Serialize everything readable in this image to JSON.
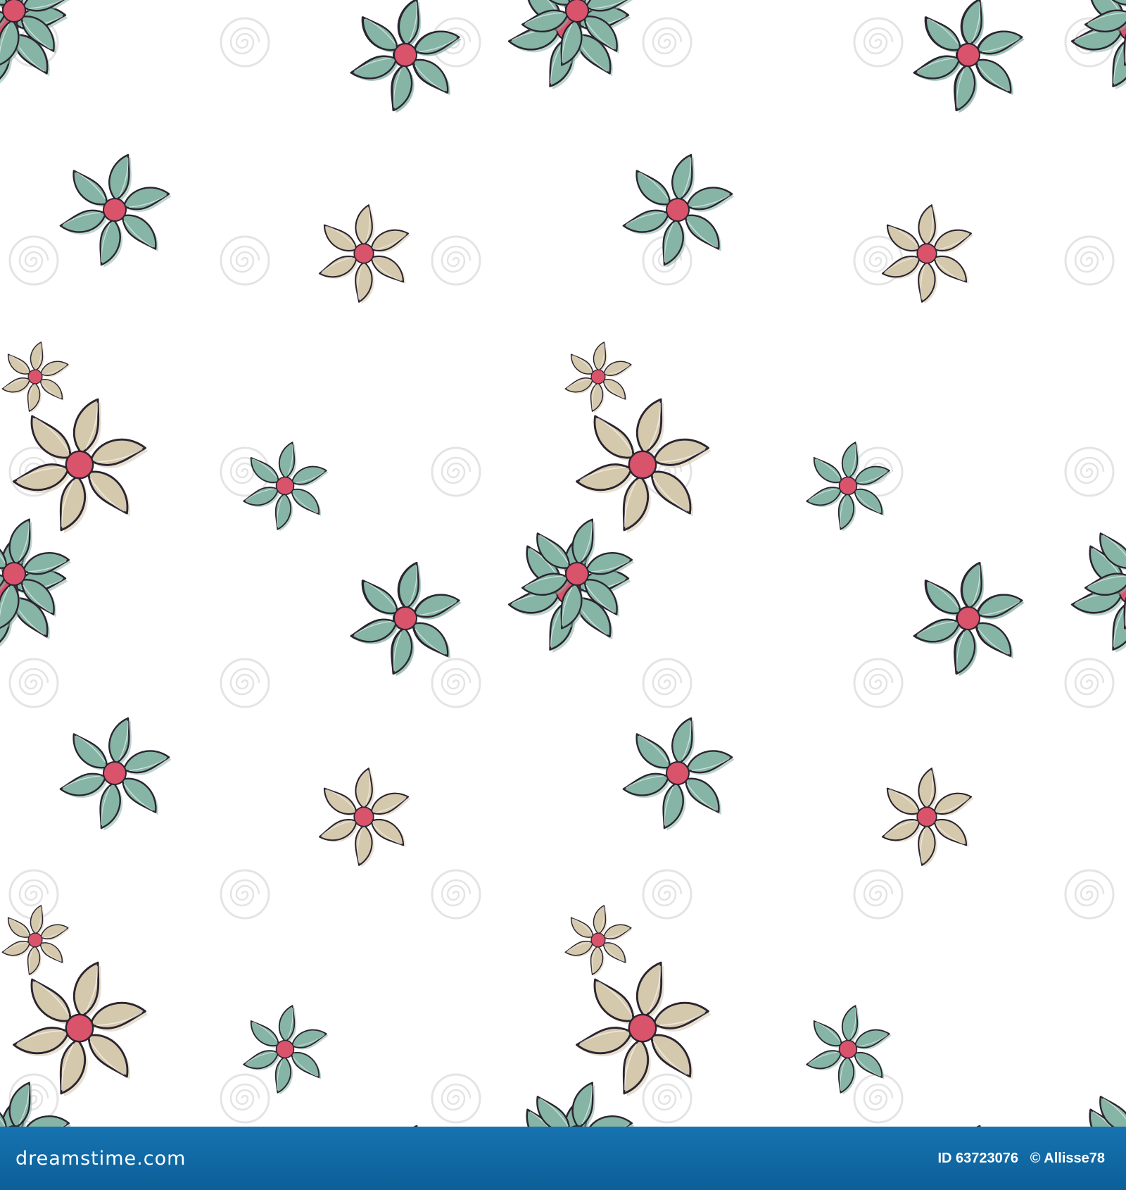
{
  "footer": {
    "logo_text": "dreamstime.com",
    "image_id": "ID 63723076",
    "copyright": "© Allisse78"
  },
  "watermark": {
    "text": "dreamstime"
  },
  "colors": {
    "teal_petal": "#86b5a5",
    "beige_petal": "#d5c9ad",
    "center": "#d9536b",
    "outline": "#2b2430",
    "footer_blue": "#1270ad"
  }
}
